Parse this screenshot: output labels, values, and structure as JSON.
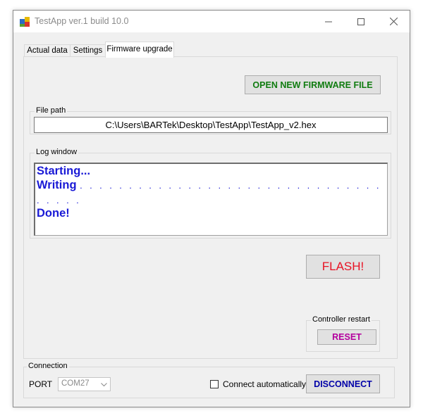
{
  "window": {
    "title": "TestApp ver.1 build 10.0",
    "controls": {
      "minimize": "—",
      "maximize": "☐",
      "close": "✕"
    }
  },
  "tabs": [
    {
      "label": "Actual data",
      "active": false
    },
    {
      "label": "Settings",
      "active": false
    },
    {
      "label": "Firmware upgrade",
      "active": true
    }
  ],
  "firmware": {
    "open_button": "OPEN NEW FIRMWARE FILE",
    "file_path_label": "File path",
    "file_path_value": "C:\\Users\\BARTek\\Desktop\\TestApp\\TestApp_v2.hex",
    "log_label": "Log window",
    "log_lines": [
      "Starting...",
      "Writing",
      "Done!"
    ],
    "log_dots_1": ". . . . . . . . . . . . . . . . . . . . . . . . . . . . . . . . . . . . . . . . . . . . . .",
    "log_dots_2": ". . . . .",
    "flash_button": "FLASH!",
    "restart_label": "Controller restart",
    "reset_button": "RESET"
  },
  "connection": {
    "label": "Connection",
    "port_label": "PORT",
    "port_value": "COM27",
    "auto_connect_label": "Connect automatically",
    "auto_connect_checked": false,
    "disconnect_button": "DISCONNECT"
  },
  "colors": {
    "open_button_text": "#107c10",
    "flash_text": "#e81123",
    "reset_text": "#b4009e",
    "disconnect_text": "#0000a8",
    "log_text": "#1a1ad6"
  }
}
